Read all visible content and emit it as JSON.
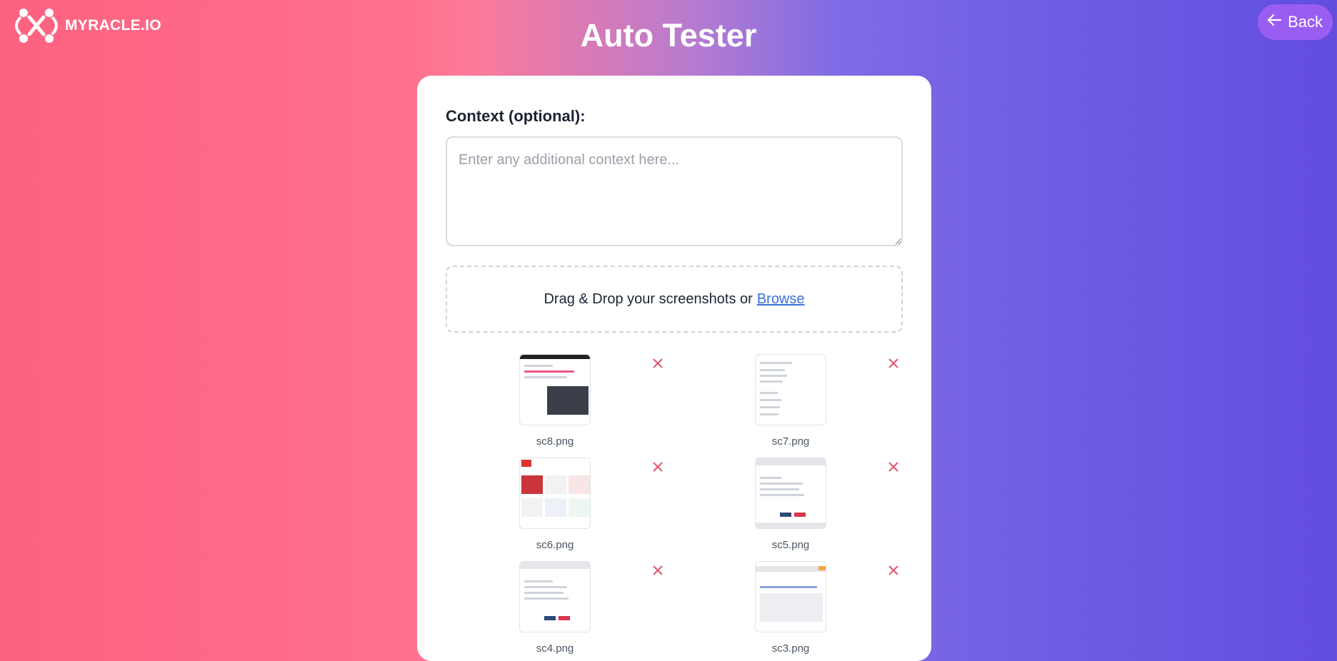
{
  "brand": {
    "name": "MYRACLE.IO",
    "logo_icon": "myracle-logo-icon"
  },
  "header": {
    "title": "Auto Tester",
    "back_label": "Back",
    "back_icon": "arrow-left-icon"
  },
  "form": {
    "context_label": "Context (optional):",
    "context_placeholder": "Enter any additional context here...",
    "context_value": "",
    "dropzone_text": "Drag & Drop your screenshots or",
    "browse_label": "Browse"
  },
  "files": [
    {
      "name": "sc8.png"
    },
    {
      "name": "sc7.png"
    },
    {
      "name": "sc6.png"
    },
    {
      "name": "sc5.png"
    },
    {
      "name": "sc4.png"
    },
    {
      "name": "sc3.png"
    }
  ],
  "colors": {
    "gradient_left": "#fd6280",
    "gradient_right": "#624ddf",
    "remove_icon": "#e0566a",
    "link": "#3a6fd8",
    "back_button": "#9a5df2"
  }
}
